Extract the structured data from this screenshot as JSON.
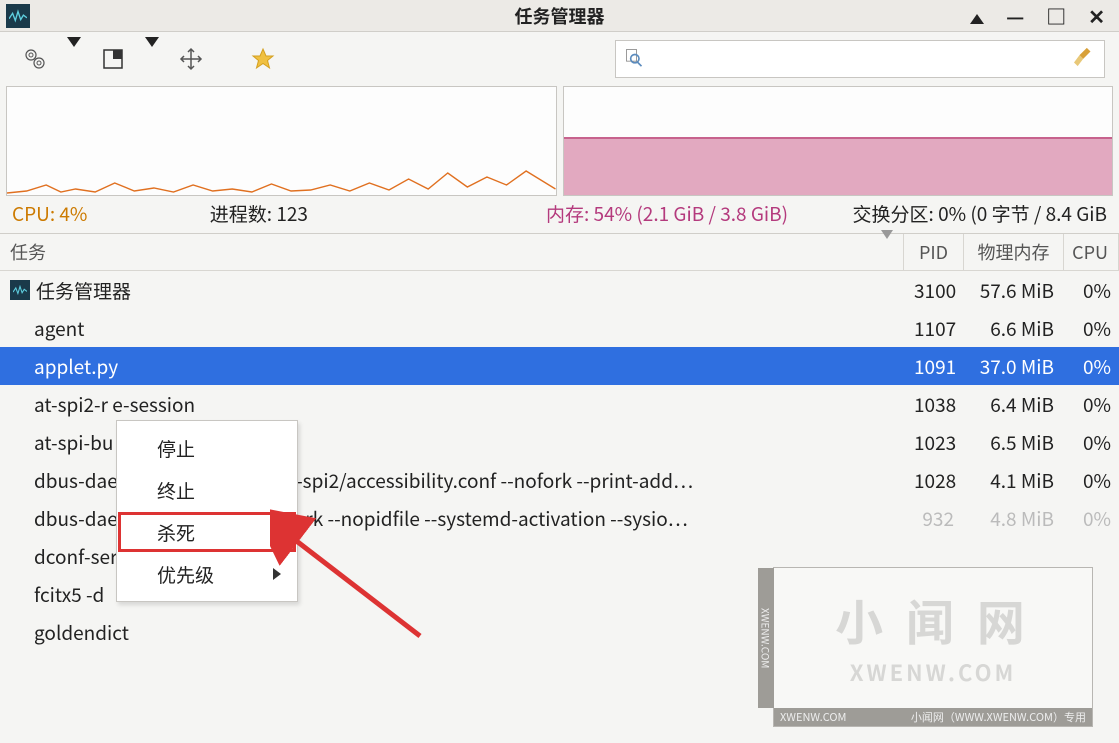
{
  "window": {
    "title": "任务管理器"
  },
  "search": {
    "placeholder": ""
  },
  "stats": {
    "cpu": "CPU: 4%",
    "processes": "进程数: 123",
    "memory": "内存: 54% (2.1 GiB / 3.8 GiB)",
    "swap": "交换分区: 0% (0 字节 / 8.4 GiB"
  },
  "columns": {
    "name": "任务",
    "pid": "PID",
    "mem": "物理内存",
    "cpu": "CPU"
  },
  "rows": [
    {
      "name": "任务管理器",
      "pid": "3100",
      "mem": "57.6 MiB",
      "cpu": "0%",
      "icon": true
    },
    {
      "name": "agent",
      "pid": "1107",
      "mem": "6.6 MiB",
      "cpu": "0%"
    },
    {
      "name": "applet.py",
      "pid": "1091",
      "mem": "37.0 MiB",
      "cpu": "0%",
      "selected": true
    },
    {
      "name": "at-spi2-r                       e-session",
      "pid": "1038",
      "mem": "6.4 MiB",
      "cpu": "0%"
    },
    {
      "name": "at-spi-bu",
      "pid": "1023",
      "mem": "6.5 MiB",
      "cpu": "0%"
    },
    {
      "name": "dbus-dae                        sr/share/defaults/at-spi2/accessibility.conf --nofork --print-add…",
      "pid": "1028",
      "mem": "4.1 MiB",
      "cpu": "0%"
    },
    {
      "name": "dbus-dae                        ress=systemd: --nofork --nopidfile --systemd-activation --sysio…",
      "pid": "932",
      "mem": "4.8 MiB",
      "cpu": "0%",
      "fade": true
    },
    {
      "name": "dconf-service",
      "pid": "",
      "mem": "",
      "cpu": "",
      "fade": true
    },
    {
      "name": "fcitx5 -d",
      "pid": "",
      "mem": "",
      "cpu": ""
    },
    {
      "name": "goldendict",
      "pid": "",
      "mem": "",
      "cpu": ""
    }
  ],
  "context_menu": {
    "items": [
      "停止",
      "终止",
      "杀死",
      "优先级"
    ],
    "highlight_index": 2,
    "submenu_index": 3
  },
  "watermark": {
    "big": "小 闻 网",
    "small": "XWENW.COM",
    "bar_left": "XWENW.COM",
    "bar_right": "小闻网（WWW.XWENW.COM）专用",
    "side": "XWENW.COM"
  },
  "icons": {
    "gear": "gear-icon",
    "view": "view-icon",
    "move": "move-icon",
    "star": "star-icon",
    "search": "search-icon",
    "broom": "broom-icon"
  }
}
